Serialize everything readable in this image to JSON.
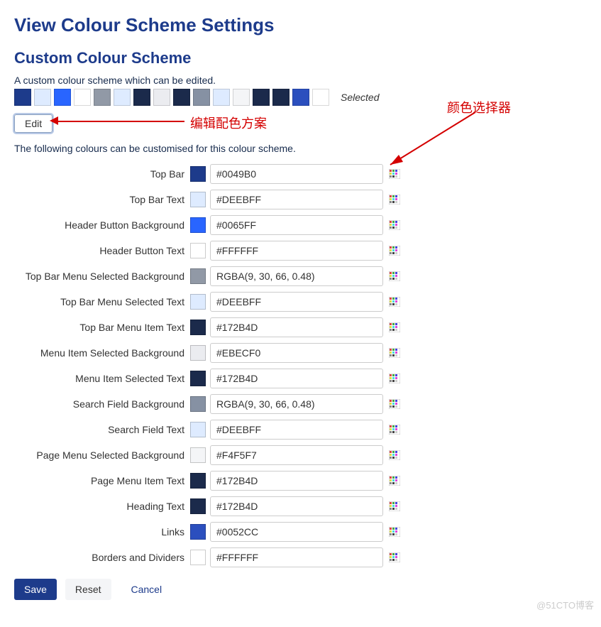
{
  "page_title": "View Colour Scheme Settings",
  "section_title": "Custom Colour Scheme",
  "desc1": "A custom colour scheme which can be edited.",
  "desc2": "The following colours can be customised for this colour scheme.",
  "selected_label": "Selected",
  "edit_label": "Edit",
  "swatches": [
    "#1D3B8B",
    "#DEEBFF",
    "#2965FF",
    "#FFFFFF",
    "#9199A6",
    "#DEEBFF",
    "#1B2A4B",
    "#EBECF0",
    "#1B2A4B",
    "#8691A3",
    "#DEEBFF",
    "#F4F5F7",
    "#1B2A4B",
    "#1B2A4B",
    "#2B4FBE",
    "#FFFFFF"
  ],
  "fields": [
    {
      "label": "Top Bar",
      "value": "#0049B0",
      "color": "#1D3B8B"
    },
    {
      "label": "Top Bar Text",
      "value": "#DEEBFF",
      "color": "#DEEBFF"
    },
    {
      "label": "Header Button Background",
      "value": "#0065FF",
      "color": "#2965FF"
    },
    {
      "label": "Header Button Text",
      "value": "#FFFFFF",
      "color": "#FFFFFF"
    },
    {
      "label": "Top Bar Menu Selected Background",
      "value": "RGBA(9, 30, 66, 0.48)",
      "color": "#9199A6"
    },
    {
      "label": "Top Bar Menu Selected Text",
      "value": "#DEEBFF",
      "color": "#DEEBFF"
    },
    {
      "label": "Top Bar Menu Item Text",
      "value": "#172B4D",
      "color": "#1B2A4B"
    },
    {
      "label": "Menu Item Selected Background",
      "value": "#EBECF0",
      "color": "#EBECF0"
    },
    {
      "label": "Menu Item Selected Text",
      "value": "#172B4D",
      "color": "#1B2A4B"
    },
    {
      "label": "Search Field Background",
      "value": "RGBA(9, 30, 66, 0.48)",
      "color": "#8691A3"
    },
    {
      "label": "Search Field Text",
      "value": "#DEEBFF",
      "color": "#DEEBFF"
    },
    {
      "label": "Page Menu Selected Background",
      "value": "#F4F5F7",
      "color": "#F4F5F7"
    },
    {
      "label": "Page Menu Item Text",
      "value": "#172B4D",
      "color": "#1B2A4B"
    },
    {
      "label": "Heading Text",
      "value": "#172B4D",
      "color": "#1B2A4B"
    },
    {
      "label": "Links",
      "value": "#0052CC",
      "color": "#2B4FBE"
    },
    {
      "label": "Borders and Dividers",
      "value": "#FFFFFF",
      "color": "#FFFFFF"
    }
  ],
  "buttons": {
    "save": "Save",
    "reset": "Reset",
    "cancel": "Cancel"
  },
  "annotations": {
    "edit_label": "编辑配色方案",
    "picker_label": "颜色选择器"
  },
  "watermark": "@51CTO博客"
}
